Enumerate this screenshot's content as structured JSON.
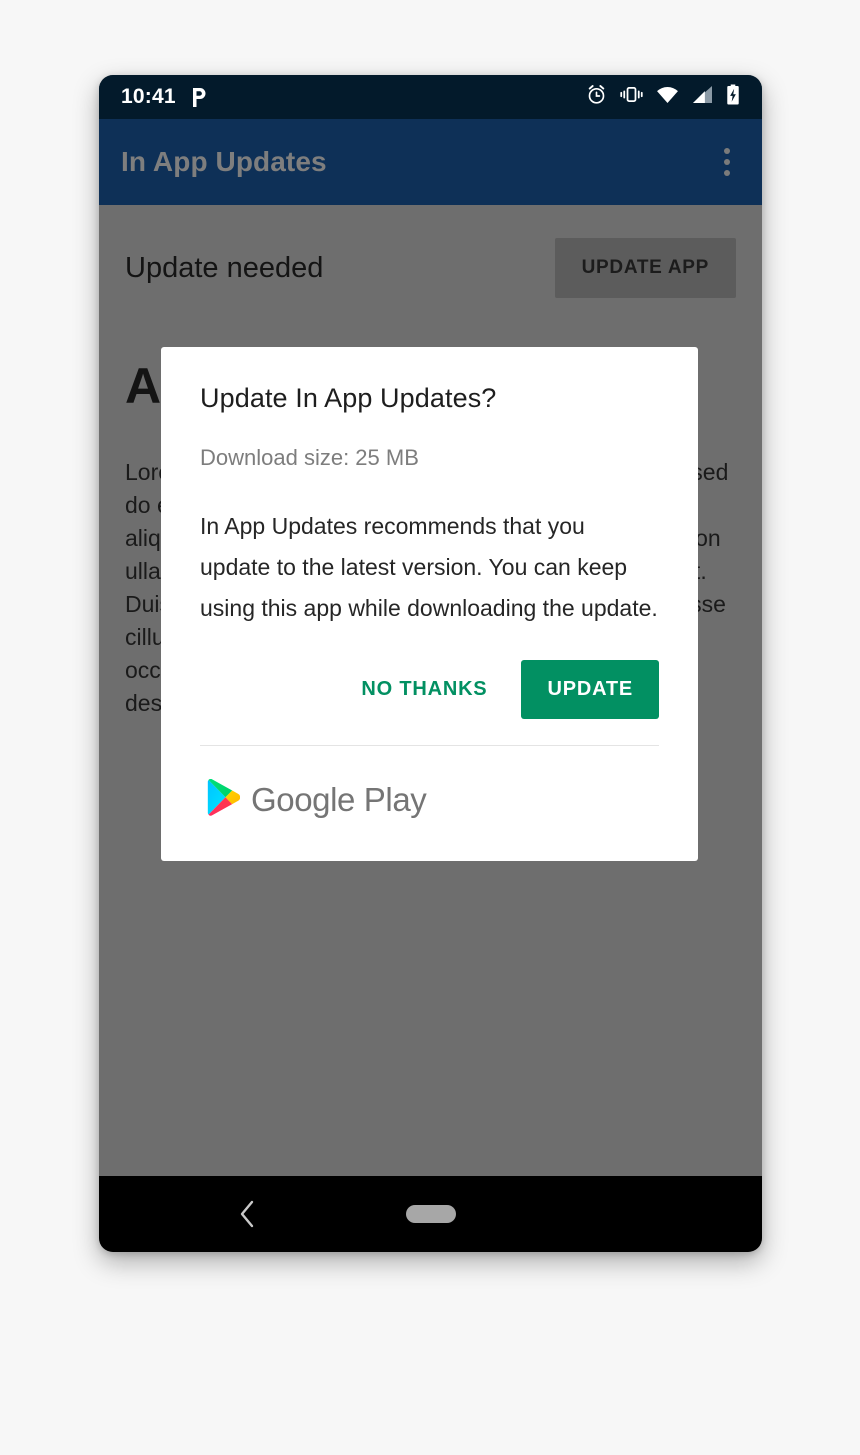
{
  "status_bar": {
    "time": "10:41",
    "icons": [
      "p-logo-icon",
      "alarm-icon",
      "vibrate-icon",
      "wifi-icon",
      "cellular-signal-icon",
      "battery-charging-icon"
    ]
  },
  "app_bar": {
    "title": "In App Updates",
    "overflow_icon": "overflow-menu-icon"
  },
  "app_content": {
    "update_needed_label": "Update needed",
    "update_app_button": "UPDATE APP",
    "heading": "About",
    "paragraph": "Lorem ipsum dolor sit amet, consectetur adipiscing elit, sed do eiusmod tempor incididunt ut labore et dolore magna aliqua. Ut enim ad minim veniam, quis nostrud exercitation ullamco laboris nisi ut aliquip ex ea commodo consequat. Duis aute irure dolor in reprehenderit in voluptate velit esse cillum dolore eu fugiat nulla pariatur. Excepteur sint occaecat cupidatat non proident, sunt in culpa qui officia deserunt mollit anim id est laborum."
  },
  "dialog": {
    "title": "Update In App Updates?",
    "download_size": "Download size: 25 MB",
    "body": "In App Updates recommends that you update to the latest version. You can keep using this app while downloading the update.",
    "no_thanks_label": "NO THANKS",
    "update_label": "UPDATE",
    "footer_brand": "Google Play",
    "footer_icon": "google-play-triangle-icon"
  },
  "nav_bar": {
    "back_icon": "back-chevron-icon",
    "home_icon": "home-pill-icon"
  },
  "colors": {
    "status_bar": "#031a2b",
    "app_bar": "#0e3057",
    "scrim": "#6e6e6e",
    "accent_green": "#029062",
    "dialog_bg": "#ffffff",
    "nav_bar": "#000000",
    "page_bg": "#f7f7f7"
  }
}
